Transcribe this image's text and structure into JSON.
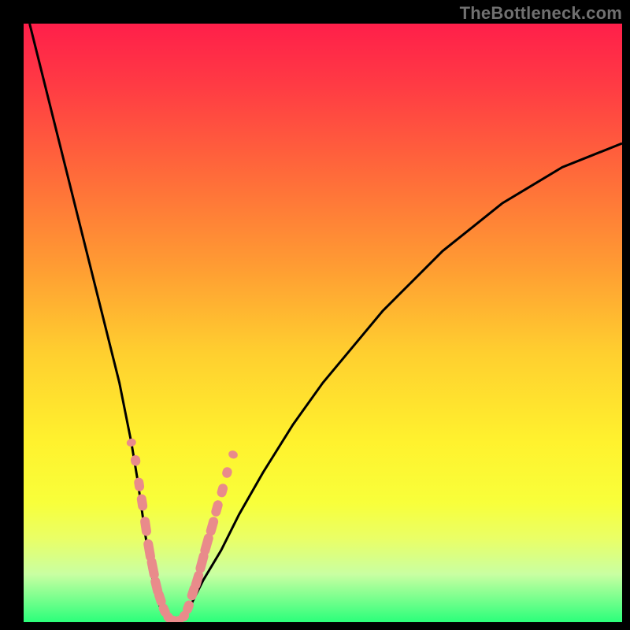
{
  "attribution": "TheBottleneck.com",
  "colors": {
    "frame": "#000000",
    "curve": "#000000",
    "marker_fill": "#e98b8b",
    "gradient_stops": [
      {
        "offset": 0.0,
        "color": "#ff1f4a"
      },
      {
        "offset": 0.1,
        "color": "#ff3a44"
      },
      {
        "offset": 0.25,
        "color": "#ff6a3a"
      },
      {
        "offset": 0.4,
        "color": "#ff9a33"
      },
      {
        "offset": 0.55,
        "color": "#ffcf2f"
      },
      {
        "offset": 0.7,
        "color": "#fff22e"
      },
      {
        "offset": 0.8,
        "color": "#f8ff3a"
      },
      {
        "offset": 0.86,
        "color": "#eaff66"
      },
      {
        "offset": 0.92,
        "color": "#c9ffa2"
      },
      {
        "offset": 1.0,
        "color": "#2bff7a"
      }
    ]
  },
  "chart_data": {
    "type": "line",
    "title": "",
    "xlabel": "",
    "ylabel": "",
    "xlim": [
      0,
      100
    ],
    "ylim": [
      0,
      100
    ],
    "grid": false,
    "legend": false,
    "series": [
      {
        "name": "bottleneck-curve",
        "x": [
          1,
          3,
          5,
          7,
          9,
          11,
          13,
          15,
          16,
          17,
          18,
          19,
          20,
          21,
          22,
          23,
          24,
          25,
          26,
          28,
          30,
          33,
          36,
          40,
          45,
          50,
          55,
          60,
          65,
          70,
          75,
          80,
          85,
          90,
          95,
          100
        ],
        "y": [
          100,
          92,
          84,
          76,
          68,
          60,
          52,
          44,
          40,
          35,
          30,
          24,
          17,
          10,
          5,
          2,
          0.5,
          0,
          0.5,
          3,
          7,
          12,
          18,
          25,
          33,
          40,
          46,
          52,
          57,
          62,
          66,
          70,
          73,
          76,
          78,
          80
        ]
      }
    ],
    "marker_clusters": [
      {
        "name": "left-cluster",
        "points": [
          {
            "x": 18.0,
            "y": 30
          },
          {
            "x": 18.7,
            "y": 27
          },
          {
            "x": 19.3,
            "y": 23
          },
          {
            "x": 19.8,
            "y": 20
          },
          {
            "x": 20.4,
            "y": 16
          },
          {
            "x": 21.0,
            "y": 12
          },
          {
            "x": 21.6,
            "y": 9
          },
          {
            "x": 22.2,
            "y": 6
          },
          {
            "x": 22.8,
            "y": 4
          },
          {
            "x": 23.5,
            "y": 2
          },
          {
            "x": 24.2,
            "y": 0.8
          },
          {
            "x": 25.0,
            "y": 0.3
          }
        ]
      },
      {
        "name": "right-cluster",
        "points": [
          {
            "x": 26.0,
            "y": 0.3
          },
          {
            "x": 26.8,
            "y": 1
          },
          {
            "x": 27.5,
            "y": 2.5
          },
          {
            "x": 28.3,
            "y": 5
          },
          {
            "x": 29.0,
            "y": 7
          },
          {
            "x": 29.8,
            "y": 10
          },
          {
            "x": 30.6,
            "y": 13
          },
          {
            "x": 31.5,
            "y": 16
          },
          {
            "x": 32.3,
            "y": 19
          },
          {
            "x": 33.2,
            "y": 22
          },
          {
            "x": 34.0,
            "y": 25
          },
          {
            "x": 35.0,
            "y": 28
          }
        ]
      }
    ]
  }
}
